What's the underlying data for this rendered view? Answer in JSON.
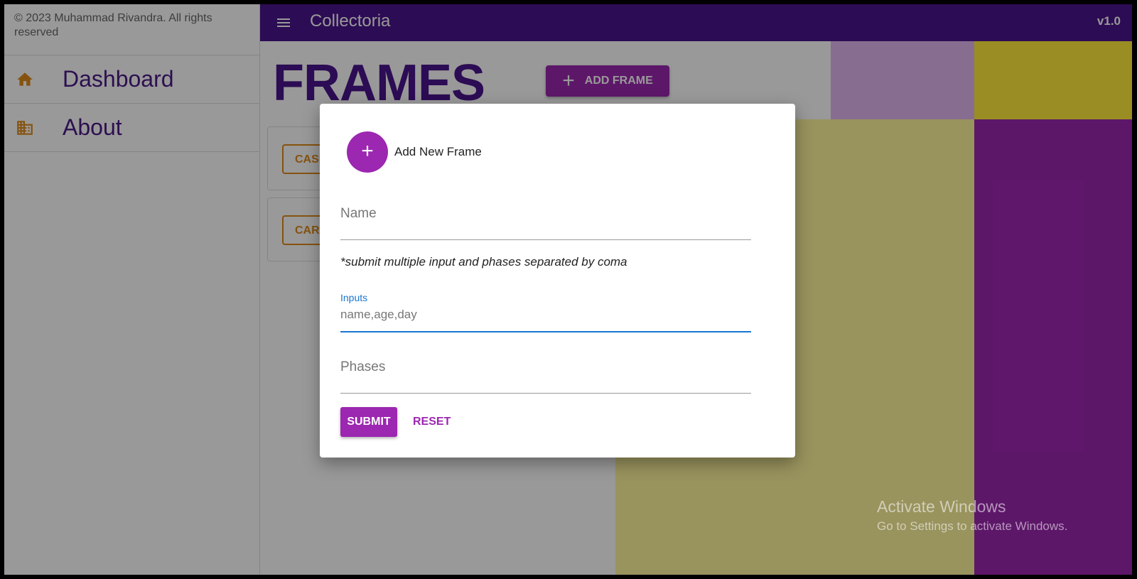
{
  "sidebar": {
    "copyright": "© 2023 Muhammad Rivandra. All rights reserved",
    "items": [
      {
        "label": "Dashboard",
        "icon": "home-icon"
      },
      {
        "label": "About",
        "icon": "building-icon"
      }
    ]
  },
  "appbar": {
    "title": "Collectoria",
    "version": "v1.0",
    "menu_icon": "menu-icon"
  },
  "main": {
    "title": "FRAMES",
    "add_button": "ADD FRAME",
    "frames": [
      "CASH",
      "CAR F"
    ]
  },
  "dialog": {
    "title": "Add New Frame",
    "name_placeholder": "Name",
    "hint": "*submit multiple input and phases separated by coma",
    "inputs_label": "Inputs",
    "inputs_value": "name,age,day",
    "phases_placeholder": "Phases",
    "submit_label": "SUBMIT",
    "reset_label": "RESET"
  },
  "watermark": {
    "title": "Activate Windows",
    "subtitle": "Go to Settings to activate Windows."
  },
  "colors": {
    "appbar": "#4a148c",
    "primary": "#9c27b0",
    "accent": "#e08a1a",
    "focus": "#1976d2"
  }
}
